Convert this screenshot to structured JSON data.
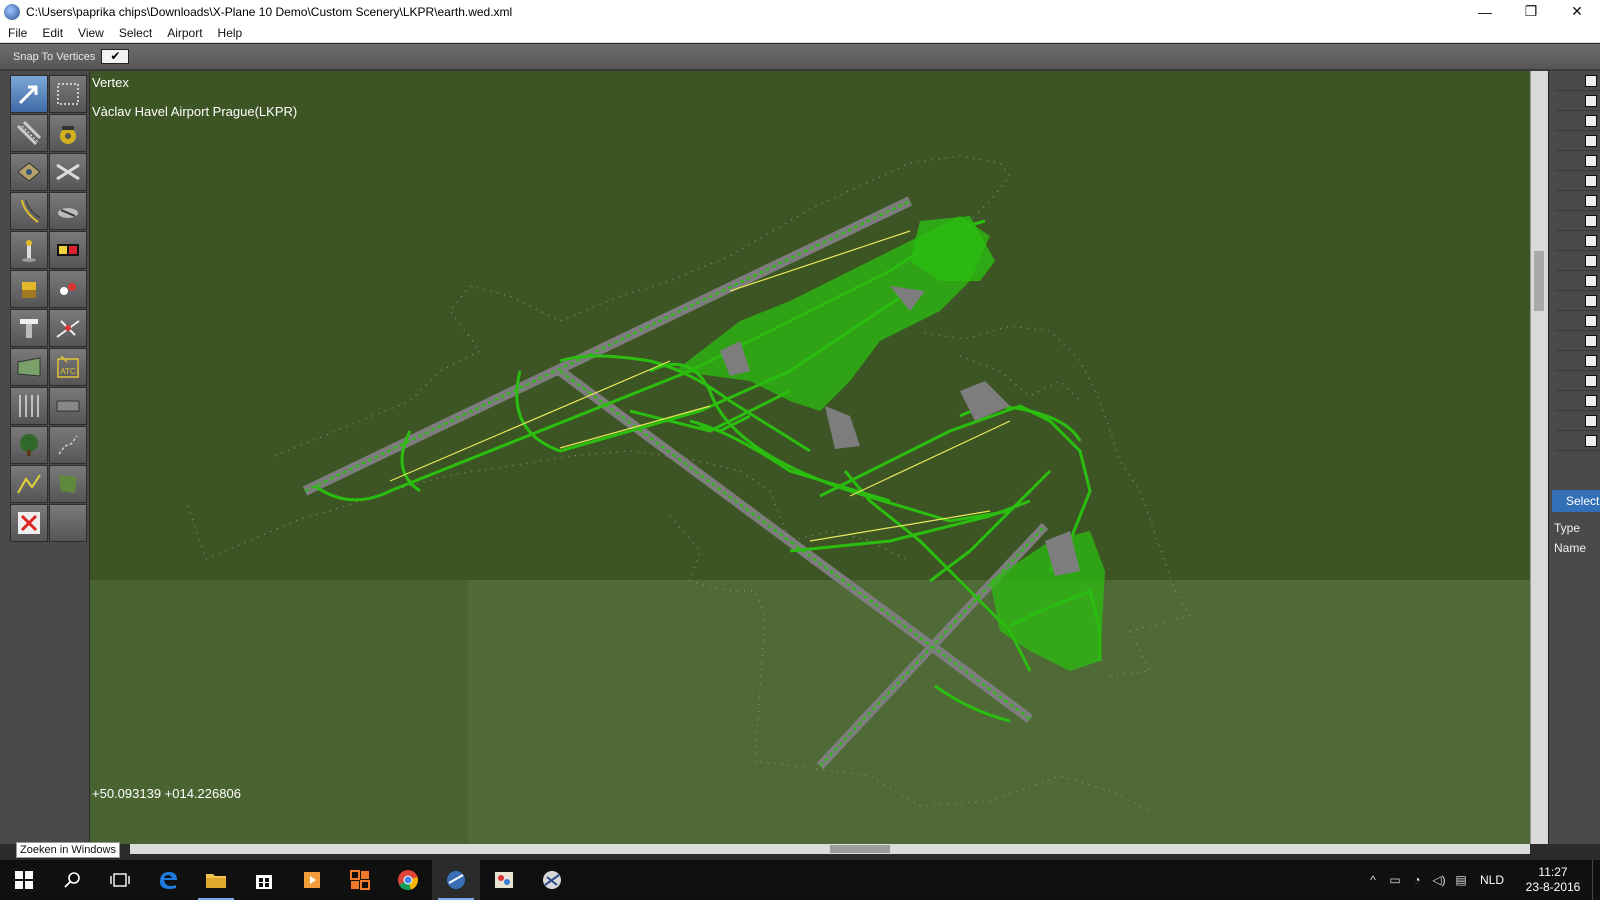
{
  "window": {
    "title": "C:\\Users\\paprika chips\\Downloads\\X-Plane 10 Demo\\Custom Scenery\\LKPR\\earth.wed.xml",
    "controls": {
      "minimize": "—",
      "restore": "❐",
      "close": "✕"
    }
  },
  "menu": [
    "File",
    "Edit",
    "View",
    "Select",
    "Airport",
    "Help"
  ],
  "options": {
    "snap_label": "Snap To Vertices",
    "snap_checked": "✔"
  },
  "tools": [
    {
      "name": "vertex-tool",
      "icon": "arrow-select-icon",
      "active": true
    },
    {
      "name": "marquee-tool",
      "icon": "marquee-icon"
    },
    {
      "name": "runway-tool",
      "icon": "runway-icon"
    },
    {
      "name": "helipad-tool",
      "icon": "helipad-icon"
    },
    {
      "name": "sealane-tool",
      "icon": "sealane-icon"
    },
    {
      "name": "taxiway-tool",
      "icon": "taxiway-icon"
    },
    {
      "name": "boundary-tool",
      "icon": "boundary-icon"
    },
    {
      "name": "ramp-start-tool",
      "icon": "ramp-start-icon"
    },
    {
      "name": "windsock-tool",
      "icon": "windsock-icon"
    },
    {
      "name": "airport-sign-tool",
      "icon": "airport-sign-icon"
    },
    {
      "name": "light-fixture-tool",
      "icon": "light-fixture-icon"
    },
    {
      "name": "beacon-tool",
      "icon": "beacon-icon"
    },
    {
      "name": "tower-viewpoint-tool",
      "icon": "tower-viewpoint-icon"
    },
    {
      "name": "taxi-route-tool",
      "icon": "taxi-route-icon"
    },
    {
      "name": "facade-tool",
      "icon": "facade-icon"
    },
    {
      "name": "atc-tool",
      "icon": "atc-icon",
      "label": "ATC"
    },
    {
      "name": "line-tool",
      "icon": "line-marking-icon"
    },
    {
      "name": "string-tool",
      "icon": "string-icon"
    },
    {
      "name": "forest-tool",
      "icon": "forest-icon"
    },
    {
      "name": "exclusion-tool",
      "icon": "exclusion-icon"
    },
    {
      "name": "polygon-tool",
      "icon": "polygon-icon"
    },
    {
      "name": "draped-polygon-tool",
      "icon": "draped-polygon-icon"
    },
    {
      "name": "delete-tool",
      "icon": "delete-x-icon"
    },
    {
      "name": "empty-tool",
      "icon": "blank-icon"
    }
  ],
  "map": {
    "tool_name": "Vertex",
    "airport_name": "Vàclav Havel Airport Prague(LKPR)",
    "coordinates": "+50.093139 +014.226806",
    "colors": {
      "background": "#3d5424",
      "selection": "#2bbd10",
      "pavement": "#7d7d7d",
      "markings": "#e8e85a",
      "boundary": "#8a9580"
    }
  },
  "right_panel": {
    "selection_tab": "Selection",
    "properties": [
      "Type",
      "Name"
    ]
  },
  "search_tooltip": "Zoeken in Windows",
  "taskbar": {
    "icons": [
      "windows-start-icon",
      "search-icon",
      "task-view-icon",
      "edge-icon",
      "file-explorer-icon",
      "store-icon",
      "media-player-icon",
      "office-app-icon",
      "chrome-icon",
      "wed-app-icon",
      "paint-app-icon",
      "xplane-icon"
    ],
    "language": "NLD",
    "time": "11:27",
    "date": "23-8-2016"
  }
}
